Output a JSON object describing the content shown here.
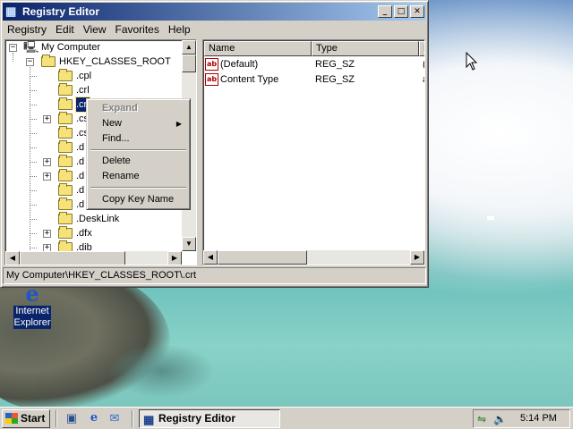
{
  "window": {
    "title": "Registry Editor",
    "controls": {
      "minimize": "_",
      "maximize": "□",
      "close": "✕"
    },
    "menu": [
      "Registry",
      "Edit",
      "View",
      "Favorites",
      "Help"
    ]
  },
  "tree": {
    "root": "My Computer",
    "hive": "HKEY_CLASSES_ROOT",
    "items": [
      {
        "label": ".cpl",
        "expandable": false
      },
      {
        "label": ".crl",
        "expandable": false
      },
      {
        "label": ".crt",
        "expandable": false,
        "selected": true
      },
      {
        "label": ".cs",
        "expandable": true
      },
      {
        "label": ".cs",
        "expandable": false
      },
      {
        "label": ".d",
        "expandable": false
      },
      {
        "label": ".d",
        "expandable": true
      },
      {
        "label": ".d",
        "expandable": true
      },
      {
        "label": ".d",
        "expandable": false
      },
      {
        "label": ".d",
        "expandable": false
      },
      {
        "label": ".DeskLink",
        "expandable": false
      },
      {
        "label": ".dfx",
        "expandable": true
      },
      {
        "label": ".dib",
        "expandable": true
      }
    ]
  },
  "list": {
    "columns": [
      "Name",
      "Type",
      "D"
    ],
    "rows": [
      {
        "icon": "ab",
        "name": "(Default)",
        "type": "REG_SZ",
        "data": "("
      },
      {
        "icon": "ab",
        "name": "Content Type",
        "type": "REG_SZ",
        "data": "a"
      }
    ]
  },
  "context_menu": {
    "expand": "Expand",
    "new": "New",
    "find": "Find...",
    "delete": "Delete",
    "rename": "Rename",
    "copy_key_name": "Copy Key Name"
  },
  "status_bar": "My Computer\\HKEY_CLASSES_ROOT\\.crt",
  "desktop_icon": {
    "label_line1": "Internet",
    "label_line2": "Explorer"
  },
  "taskbar": {
    "start": "Start",
    "task": "Registry Editor",
    "clock": "5:14 PM"
  }
}
